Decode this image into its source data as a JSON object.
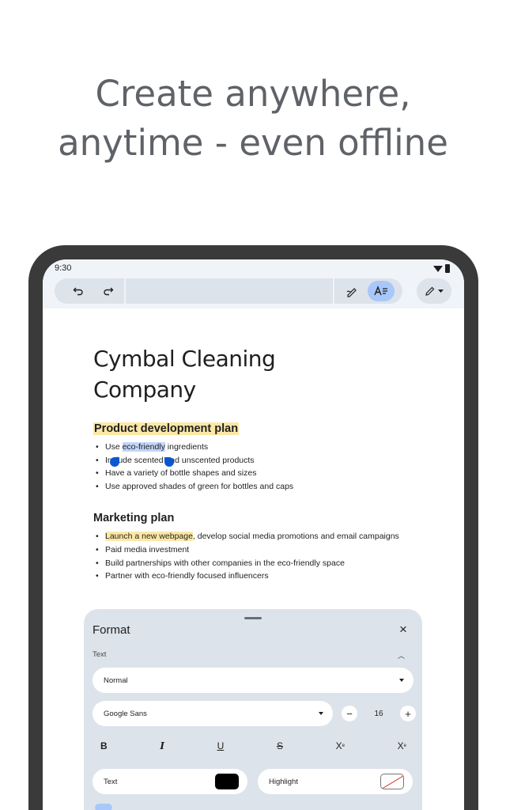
{
  "headline": [
    "Create anywhere,",
    "anytime - even offline"
  ],
  "status_bar": {
    "time": "9:30"
  },
  "document": {
    "title": [
      "Cymbal Cleaning",
      "Company"
    ],
    "section1": {
      "heading": "Product development plan",
      "items": [
        {
          "before": "Use ",
          "selected": "eco-friendly",
          "after": " ingredients"
        },
        "Include scented and unscented products",
        "Have a variety of bottle shapes and sizes",
        "Use approved shades of green for bottles and caps"
      ]
    },
    "section2": {
      "heading": "Marketing plan",
      "items": [
        {
          "highlighted": "Launch a new webpage",
          "after": ", develop social media promotions and email campaigns"
        },
        "Paid media investment",
        "Build partnerships with other companies in the eco-friendly space",
        "Partner with eco-friendly focused influencers"
      ]
    }
  },
  "format_panel": {
    "title": "Format",
    "close_icon": "×",
    "section_label": "Text",
    "collapse_icon": "︿",
    "style_value": "Normal",
    "font_value": "Google Sans",
    "size_minus": "−",
    "font_size": "16",
    "size_plus": "+",
    "bold": "B",
    "italic": "I",
    "underline": "U",
    "strikethrough": "S",
    "superscript": "X",
    "superscript_mark": "e",
    "subscript": "X",
    "subscript_mark": "e",
    "text_color_label": "Text",
    "highlight_label": "Highlight",
    "text_color": "#000000"
  },
  "colors": {
    "accent": "#a8c7fa",
    "selection": "#c2d6f8",
    "highlight": "#fce8a6",
    "panel": "#dde3ea",
    "device": "#3a3a3a"
  }
}
